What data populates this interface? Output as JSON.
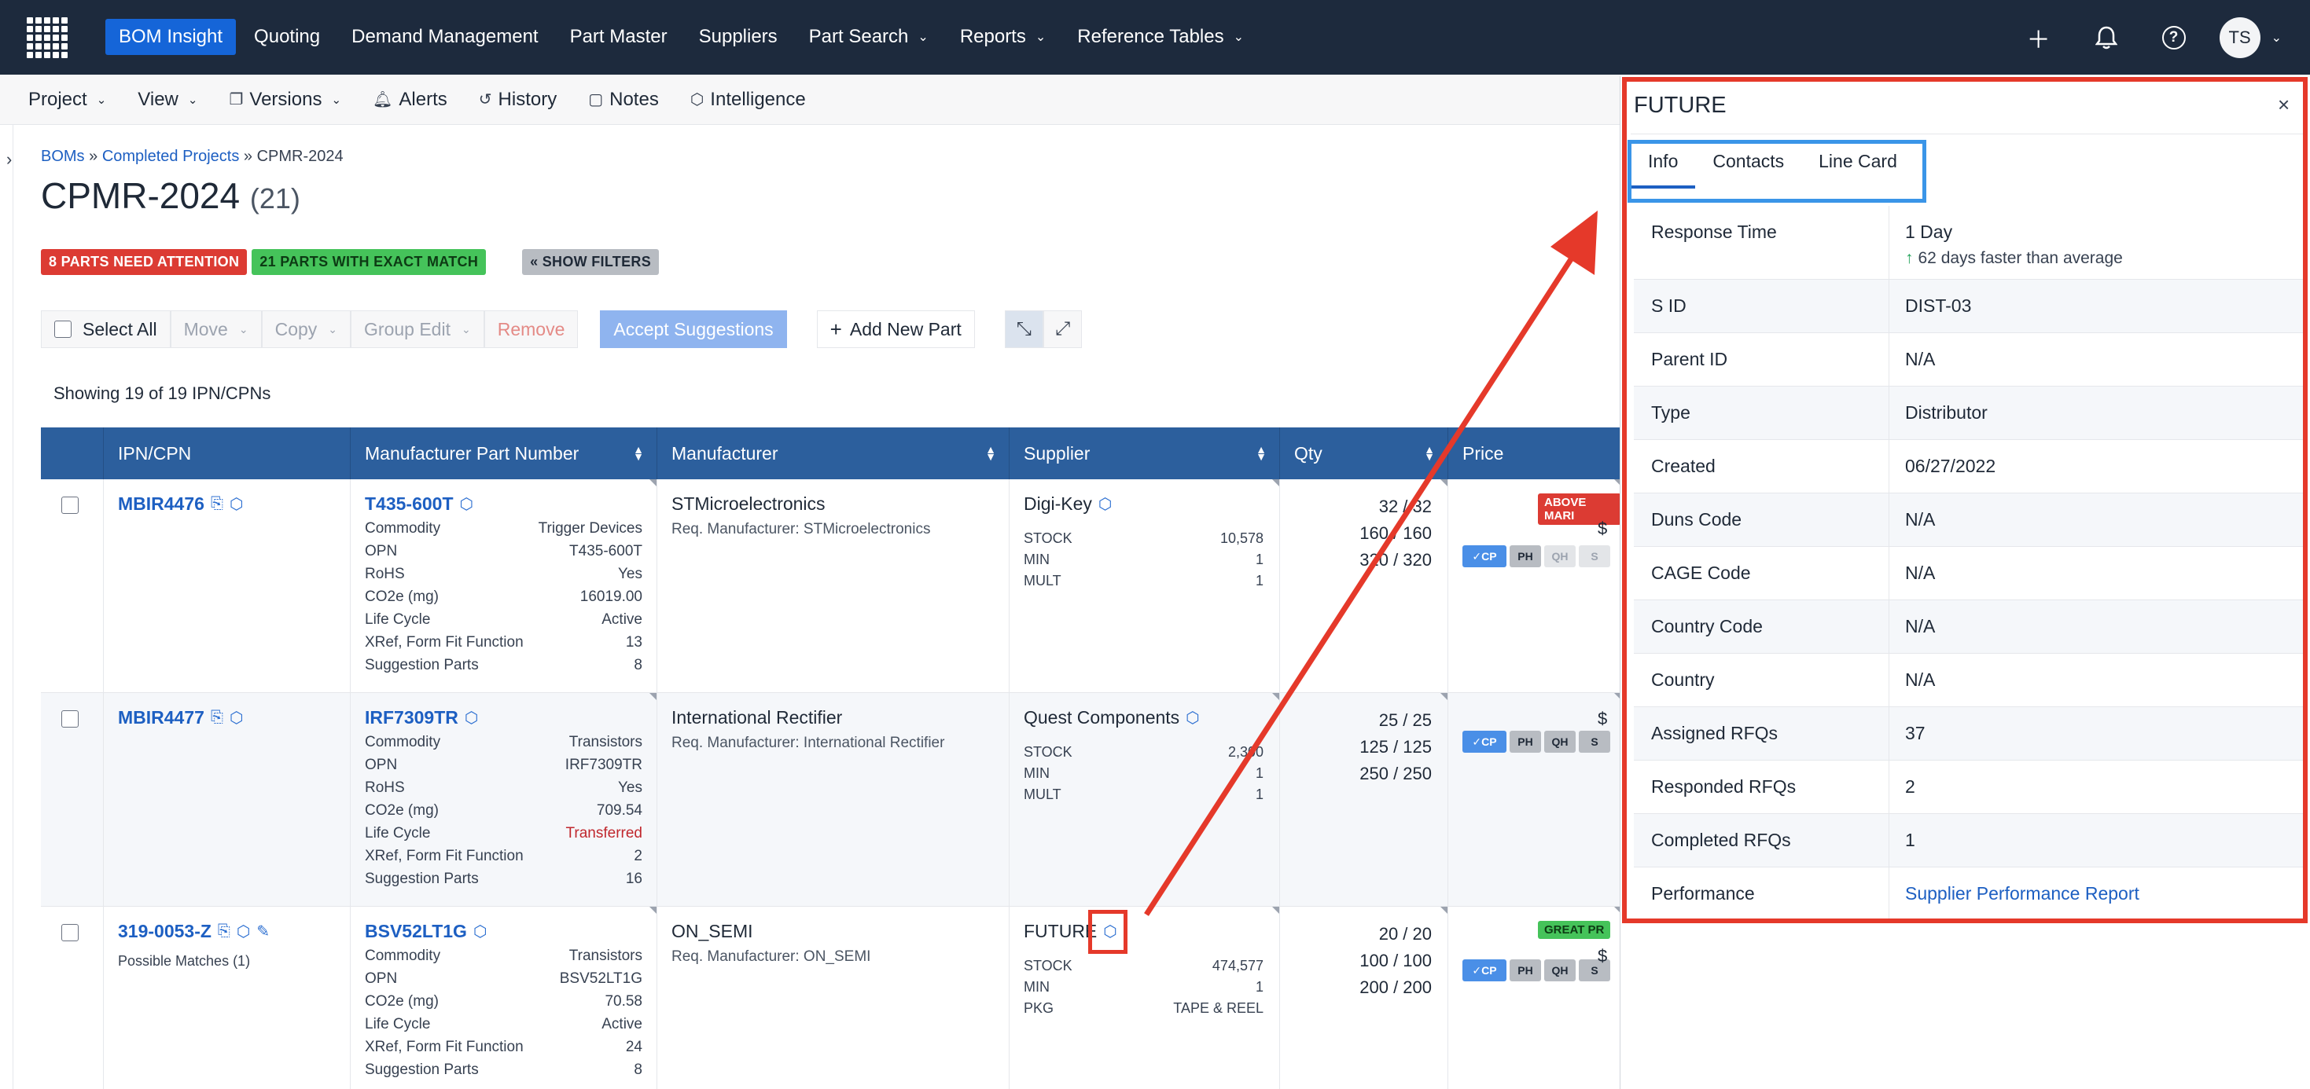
{
  "nav": {
    "items": [
      {
        "label": "BOM Insight",
        "active": true,
        "dropdown": false
      },
      {
        "label": "Quoting",
        "active": false,
        "dropdown": false
      },
      {
        "label": "Demand Management",
        "active": false,
        "dropdown": false
      },
      {
        "label": "Part Master",
        "active": false,
        "dropdown": false
      },
      {
        "label": "Suppliers",
        "active": false,
        "dropdown": false
      },
      {
        "label": "Part Search",
        "active": false,
        "dropdown": true
      },
      {
        "label": "Reports",
        "active": false,
        "dropdown": true
      },
      {
        "label": "Reference Tables",
        "active": false,
        "dropdown": true
      }
    ],
    "avatar_initials": "TS",
    "icons": [
      "plus-icon",
      "bell-icon",
      "help-icon"
    ]
  },
  "subbar": {
    "project": "Project",
    "view": "View",
    "versions": "Versions",
    "alerts": "Alerts",
    "history": "History",
    "notes": "Notes",
    "intelligence": "Intelligence"
  },
  "breadcrumb": {
    "root": "BOMs",
    "sep": "»",
    "parent": "Completed Projects",
    "current": "CPMR-2024"
  },
  "title": {
    "name": "CPMR-2024",
    "count": "(21)"
  },
  "badges": {
    "attention": "8 PARTS NEED ATTENTION",
    "exact": "21 PARTS WITH EXACT MATCH",
    "filters": "« SHOW FILTERS"
  },
  "actions": {
    "select_all": "Select All",
    "move": "Move",
    "copy": "Copy",
    "group_edit": "Group Edit",
    "remove": "Remove",
    "accept": "Accept Suggestions",
    "add": "Add New Part"
  },
  "showing": "Showing 19 of 19 IPN/CPNs",
  "table": {
    "headers": {
      "ipn": "IPN/CPN",
      "mpn": "Manufacturer Part Number",
      "manufacturer": "Manufacturer",
      "supplier": "Supplier",
      "qty": "Qty",
      "price": "Price"
    },
    "rows": [
      {
        "ipn": "MBIR4476",
        "ipn_note": "",
        "mpn": "T435-600T",
        "attrs": [
          {
            "k": "Commodity",
            "v": "Trigger Devices"
          },
          {
            "k": "OPN",
            "v": "T435-600T"
          },
          {
            "k": "RoHS",
            "v": "Yes"
          },
          {
            "k": "CO2e (mg)",
            "v": "16019.00"
          },
          {
            "k": "Life Cycle",
            "v": "Active"
          },
          {
            "k": "XRef, Form Fit Function",
            "v": "13"
          },
          {
            "k": "Suggestion Parts",
            "v": "8"
          }
        ],
        "manufacturer": "STMicroelectronics",
        "req_mfr": "Req. Manufacturer: STMicroelectronics",
        "supplier": "Digi-Key",
        "sup_attrs": [
          {
            "k": "STOCK",
            "v": "10,578"
          },
          {
            "k": "MIN",
            "v": "1"
          },
          {
            "k": "MULT",
            "v": "1"
          }
        ],
        "qty": [
          "32 / 32",
          "160 / 160",
          "320 / 320"
        ],
        "flag": "ABOVE MARI",
        "flag_color": "red",
        "price_frag": "$"
      },
      {
        "ipn": "MBIR4477",
        "ipn_note": "",
        "mpn": "IRF7309TR",
        "attrs": [
          {
            "k": "Commodity",
            "v": "Transistors"
          },
          {
            "k": "OPN",
            "v": "IRF7309TR"
          },
          {
            "k": "RoHS",
            "v": "Yes"
          },
          {
            "k": "CO2e (mg)",
            "v": "709.54"
          },
          {
            "k": "Life Cycle",
            "v": "Transferred"
          },
          {
            "k": "XRef, Form Fit Function",
            "v": "2"
          },
          {
            "k": "Suggestion Parts",
            "v": "16"
          }
        ],
        "manufacturer": "International Rectifier",
        "req_mfr": "Req. Manufacturer: International Rectifier",
        "supplier": "Quest Components",
        "sup_attrs": [
          {
            "k": "STOCK",
            "v": "2,300"
          },
          {
            "k": "MIN",
            "v": "1"
          },
          {
            "k": "MULT",
            "v": "1"
          }
        ],
        "qty": [
          "25 / 25",
          "125 / 125",
          "250 / 250"
        ],
        "flag": "",
        "flag_color": "",
        "price_frag": "$"
      },
      {
        "ipn": "319-0053-Z",
        "ipn_note": "Possible Matches (1)",
        "mpn": "BSV52LT1G",
        "attrs": [
          {
            "k": "Commodity",
            "v": "Transistors"
          },
          {
            "k": "OPN",
            "v": "BSV52LT1G"
          },
          {
            "k": "CO2e (mg)",
            "v": "70.58"
          },
          {
            "k": "Life Cycle",
            "v": "Active"
          },
          {
            "k": "XRef, Form Fit Function",
            "v": "24"
          },
          {
            "k": "Suggestion Parts",
            "v": "8"
          }
        ],
        "manufacturer": "ON_SEMI",
        "req_mfr": "Req. Manufacturer: ON_SEMI",
        "supplier": "FUTURE",
        "sup_attrs": [
          {
            "k": "STOCK",
            "v": "474,577"
          },
          {
            "k": "MIN",
            "v": "1"
          },
          {
            "k": "PKG",
            "v": "TAPE & REEL"
          }
        ],
        "qty": [
          "20 / 20",
          "100 / 100",
          "200 / 200"
        ],
        "flag": "GREAT PR",
        "flag_color": "green",
        "price_frag": "$"
      }
    ],
    "chips": [
      "✓CP",
      "PH",
      "QH",
      "S"
    ]
  },
  "panel": {
    "title": "FUTURE",
    "close": "×",
    "tabs": [
      "Info",
      "Contacts",
      "Line Card"
    ],
    "info": [
      {
        "k": "Response Time",
        "v": "1 Day",
        "sub": "62 days faster than average"
      },
      {
        "k": "S ID",
        "v": "DIST-03"
      },
      {
        "k": "Parent ID",
        "v": "N/A"
      },
      {
        "k": "Type",
        "v": "Distributor"
      },
      {
        "k": "Created",
        "v": "06/27/2022"
      },
      {
        "k": "Duns Code",
        "v": "N/A"
      },
      {
        "k": "CAGE Code",
        "v": "N/A"
      },
      {
        "k": "Country Code",
        "v": "N/A"
      },
      {
        "k": "Country",
        "v": "N/A"
      },
      {
        "k": "Assigned RFQs",
        "v": "37"
      },
      {
        "k": "Responded RFQs",
        "v": "2"
      },
      {
        "k": "Completed RFQs",
        "v": "1"
      },
      {
        "k": "Performance",
        "v": "Supplier Performance Report",
        "link": true
      }
    ]
  },
  "colors": {
    "nav_bg": "#1d2a3d",
    "accent": "#1565d8",
    "table_header": "#2c5f9d",
    "annotation": "#e5392a",
    "tab_highlight": "#3a95e8"
  }
}
